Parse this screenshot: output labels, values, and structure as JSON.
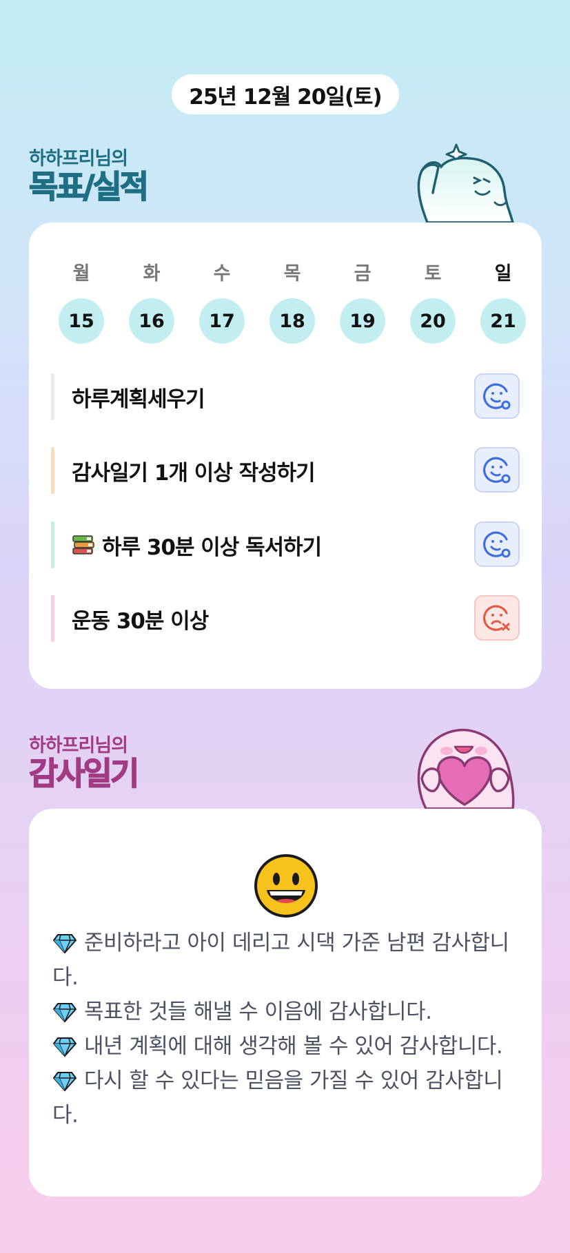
{
  "header": {
    "date": "25년 12월 20일(토)"
  },
  "goals_section": {
    "subtitle": "하하프리님의",
    "title": "목표/실적"
  },
  "week": [
    {
      "day": "월",
      "date": "15"
    },
    {
      "day": "화",
      "date": "16"
    },
    {
      "day": "수",
      "date": "17"
    },
    {
      "day": "목",
      "date": "18"
    },
    {
      "day": "금",
      "date": "19"
    },
    {
      "day": "토",
      "date": "20"
    },
    {
      "day": "일",
      "date": "21"
    }
  ],
  "goals": [
    {
      "label": "하루계획세우기",
      "status": "done",
      "bar_color": "#ebebeb"
    },
    {
      "label": "감사일기 1개 이상 작성하기",
      "status": "done",
      "bar_color": "#f8dfbc"
    },
    {
      "label": "하루 30분 이상 독서하기",
      "status": "done",
      "bar_color": "#c4eedb",
      "icon": "books-icon"
    },
    {
      "label": "운동 30분 이상",
      "status": "failed",
      "bar_color": "#f6cfe6"
    }
  ],
  "diary_section": {
    "subtitle": "하하프리님의",
    "title": "감사일기"
  },
  "diary": {
    "mood_icon": "grinning-face-icon",
    "entries": [
      "준비하라고 아이 데리고 시댁 가준 남편 감사합니다.",
      "목표한 것들 해낼 수 이음에 감사합니다.",
      "내년 계획에 대해 생각해 볼 수 있어 감사합니다.",
      "다시 할 수 있다는 믿음을 가질 수 있어 감사합니다."
    ],
    "bullet_icon": "gem-icon"
  },
  "colors": {
    "goal_title": "#1e6f84",
    "diary_title": "#a13b83",
    "day_circle": "#c2eef2",
    "ok_icon": "#3d6ee0",
    "fail_icon": "#e05a45"
  }
}
